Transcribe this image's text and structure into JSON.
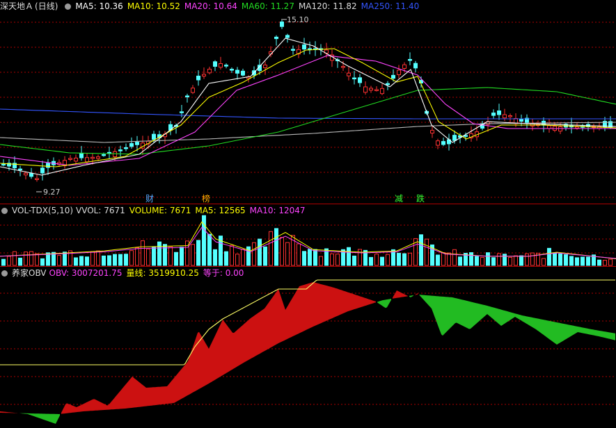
{
  "price": {
    "title": "深天地Ａ",
    "period": "(日线)",
    "ma": [
      {
        "label": "MA5: 10.36",
        "color": "#ffffff"
      },
      {
        "label": "MA10: 10.52",
        "color": "#ffff00"
      },
      {
        "label": "MA20: 10.64",
        "color": "#ff44ff"
      },
      {
        "label": "MA60: 11.27",
        "color": "#22dd22"
      },
      {
        "label": "MA120: 11.82",
        "color": "#dddddd"
      },
      {
        "label": "MA250: 11.40",
        "color": "#3355ff"
      }
    ],
    "high_label": "15.10",
    "low_label": "9.27",
    "events": [
      {
        "text": "财",
        "color": "#55aaff"
      },
      {
        "text": "榜",
        "color": "#ffaa00"
      },
      {
        "text": "减",
        "color": "#33ff33"
      },
      {
        "text": "跌",
        "color": "#33ff33"
      }
    ]
  },
  "volume": {
    "name": "VOL-TDX(5,10)",
    "items": [
      {
        "label": "VVOL: 7671",
        "color": "#dddddd"
      },
      {
        "label": "VOLUME: 7671",
        "color": "#ffff00"
      },
      {
        "label": "MA5: 12565",
        "color": "#ffff00"
      },
      {
        "label": "MA10: 12047",
        "color": "#ff44ff"
      }
    ]
  },
  "obv": {
    "name": "养家OBV",
    "items": [
      {
        "label": "OBV: 3007201.75",
        "color": "#ff44ff"
      },
      {
        "label": "量线: 3519910.25",
        "color": "#ffff00"
      },
      {
        "label": "等于: 0.00",
        "color": "#ff44ff"
      }
    ]
  },
  "colors": {
    "up": "#ff3232",
    "down": "#54ffff",
    "grid": "#b00000",
    "obv_up": "#cc1111",
    "obv_down": "#22bb22"
  }
}
